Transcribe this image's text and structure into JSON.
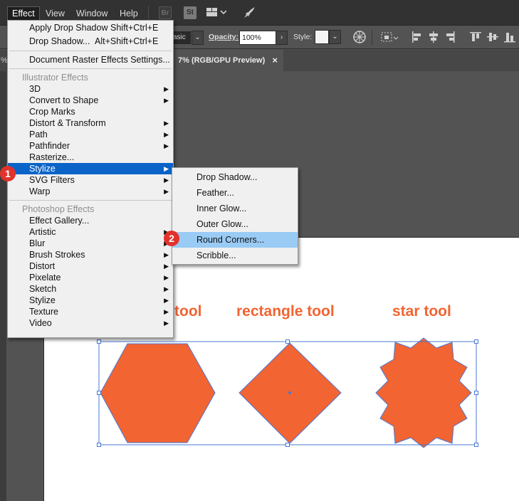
{
  "menubar": {
    "items": [
      "Effect",
      "View",
      "Window",
      "Help"
    ],
    "bridge_label": "Br",
    "stock_label": "St"
  },
  "ctrlbar": {
    "style_preset": "asic",
    "opacity_label": "Opacity:",
    "opacity_value": "100%",
    "style_label": "Style:"
  },
  "doc_tab": {
    "title": "7% (RGB/GPU Preview)",
    "close": "×",
    "left_fragment": "%"
  },
  "effect_menu": {
    "apply_last": {
      "label": "Apply Drop Shadow",
      "shortcut": "Shift+Ctrl+E"
    },
    "last_effect": {
      "label": "Drop Shadow...",
      "shortcut": "Alt+Shift+Ctrl+E"
    },
    "doc_raster": "Document Raster Effects Settings...",
    "illustrator_header": "Illustrator Effects",
    "illustrator_items": [
      "3D",
      "Convert to Shape",
      "Crop Marks",
      "Distort & Transform",
      "Path",
      "Pathfinder",
      "Rasterize...",
      "Stylize",
      "SVG Filters",
      "Warp"
    ],
    "photoshop_header": "Photoshop Effects",
    "photoshop_items": [
      "Effect Gallery...",
      "Artistic",
      "Blur",
      "Brush Strokes",
      "Distort",
      "Pixelate",
      "Sketch",
      "Stylize",
      "Texture",
      "Video"
    ]
  },
  "stylize_submenu": {
    "items": [
      "Drop Shadow...",
      "Feather...",
      "Inner Glow...",
      "Outer Glow...",
      "Round Corners...",
      "Scribble..."
    ],
    "highlighted": "Round Corners..."
  },
  "callouts": {
    "step1": "1",
    "step2": "2"
  },
  "artboard": {
    "labels": {
      "polygon": "tool",
      "rectangle": "rectangle tool",
      "star": "star tool"
    },
    "shape_color": "#f26432",
    "selection_color": "#4a78d6"
  }
}
